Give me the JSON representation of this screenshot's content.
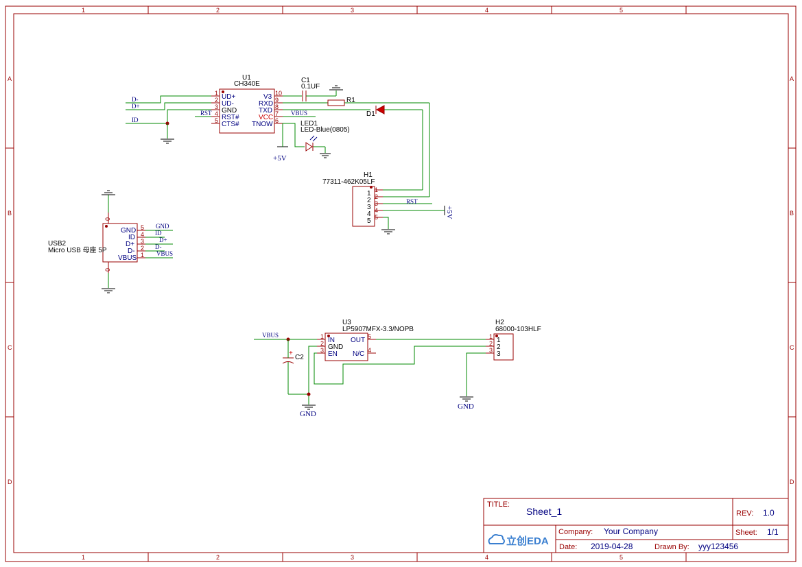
{
  "frame": {
    "columns": [
      "1",
      "2",
      "3",
      "4",
      "5"
    ],
    "rows": [
      "A",
      "B",
      "C",
      "D"
    ]
  },
  "title_block": {
    "title_label": "TITLE:",
    "title_value": "Sheet_1",
    "rev_label": "REV:",
    "rev_value": "1.0",
    "company_label": "Company:",
    "company_value": "Your Company",
    "sheet_label": "Sheet:",
    "sheet_value": "1/1",
    "date_label": "Date:",
    "date_value": "2019-04-28",
    "drawn_label": "Drawn By:",
    "drawn_value": "yyy123456",
    "logo_text": "立创EDA"
  },
  "u1": {
    "ref": "U1",
    "value": "CH340E",
    "left_pins": [
      {
        "num": "1",
        "name": "UD+"
      },
      {
        "num": "2",
        "name": "UD-"
      },
      {
        "num": "3",
        "name": "GND"
      },
      {
        "num": "4",
        "name": "RST#"
      },
      {
        "num": "5",
        "name": "CTS#"
      }
    ],
    "right_pins": [
      {
        "num": "10",
        "name": "V3"
      },
      {
        "num": "9",
        "name": "RXD"
      },
      {
        "num": "8",
        "name": "TXD"
      },
      {
        "num": "7",
        "name": "VCC"
      },
      {
        "num": "6",
        "name": "TNOW"
      }
    ]
  },
  "c1": {
    "ref": "C1",
    "value": "0.1UF"
  },
  "r1": {
    "ref": "R1"
  },
  "d1": {
    "ref": "D1"
  },
  "led1": {
    "ref": "LED1",
    "value": "LED-Blue(0805)"
  },
  "h1": {
    "ref": "H1",
    "value": "77311-462K05LF",
    "pins": [
      "1",
      "2",
      "3",
      "4",
      "5"
    ],
    "pin_nums": [
      "1",
      "2",
      "3",
      "4",
      "5"
    ]
  },
  "usb2": {
    "ref": "USB2",
    "value": "Micro USB 母座 5P",
    "pins": [
      {
        "num": "5",
        "name": "GND"
      },
      {
        "num": "4",
        "name": "ID"
      },
      {
        "num": "3",
        "name": "D+"
      },
      {
        "num": "2",
        "name": "D-"
      },
      {
        "num": "1",
        "name": "VBUS"
      }
    ],
    "shield_top": "0",
    "shield_bottom": "0"
  },
  "u3": {
    "ref": "U3",
    "value": "LP5907MFX-3.3/NOPB",
    "left_pins": [
      {
        "num": "1",
        "name": "IN"
      },
      {
        "num": "2",
        "name": "GND"
      },
      {
        "num": "3",
        "name": "EN"
      }
    ],
    "right_pins": [
      {
        "num": "5",
        "name": "OUT"
      },
      {
        "num": "4",
        "name": "N/C"
      }
    ]
  },
  "c2": {
    "ref": "C2",
    "plus": "+"
  },
  "h2": {
    "ref": "H2",
    "value": "68000-103HLF",
    "pins": [
      "1",
      "2",
      "3"
    ],
    "pin_nums": [
      "1",
      "2",
      "3"
    ]
  },
  "nets": {
    "d_minus": "D-",
    "d_plus": "D+",
    "id": "ID",
    "rst": "RST",
    "vbus": "VBUS",
    "gnd": "GND",
    "plus5v": "+5V"
  }
}
